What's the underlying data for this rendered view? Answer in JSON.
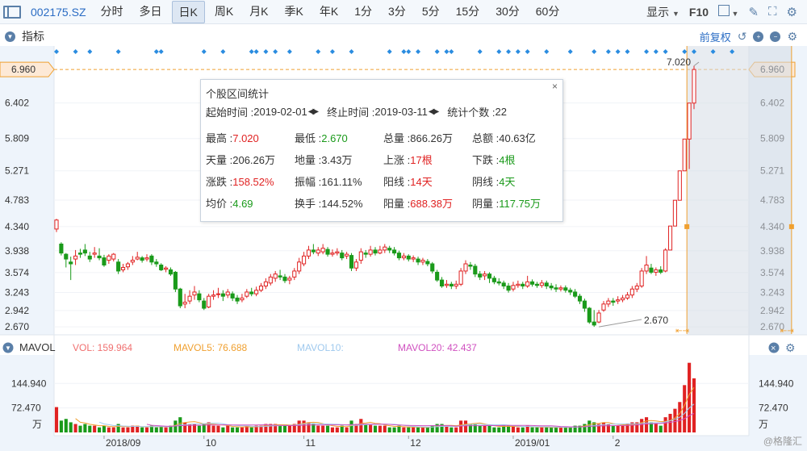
{
  "toolbar": {
    "code": "002175.SZ",
    "periods": [
      "分时",
      "多日",
      "日K",
      "周K",
      "月K",
      "季K",
      "年K",
      "1分",
      "3分",
      "5分",
      "15分",
      "30分",
      "60分"
    ],
    "active_period": "日K",
    "display_label": "显示",
    "f10_label": "F10",
    "icons": [
      "sidebar-toggle-icon",
      "checkbox-icon",
      "pen-icon",
      "expand-icon",
      "settings-icon"
    ]
  },
  "indicator_bar": {
    "label": "指标",
    "adjust_label": "前复权",
    "icons": [
      "collapse-icon",
      "undo-icon",
      "plus-icon",
      "minus-icon",
      "settings-icon"
    ]
  },
  "price_axis": {
    "current_price": "6.960",
    "ticks": [
      "6.402",
      "5.809",
      "5.271",
      "4.783",
      "4.340",
      "3.938",
      "3.574",
      "3.243",
      "2.942",
      "2.670"
    ]
  },
  "annotations": {
    "high_label": "7.020",
    "low_label": "2.670"
  },
  "popup": {
    "title": "个股区间统计",
    "close": "×",
    "start_label": "起始时间 :",
    "start_value": "2019-02-01",
    "end_label": "终止时间 :",
    "end_value": "2019-03-11",
    "count_label": "统计个数 :",
    "count_value": "22",
    "rows": [
      [
        {
          "label": "最高 :",
          "value": "7.020",
          "color": "red"
        },
        {
          "label": "最低 :",
          "value": "2.670",
          "color": "green"
        },
        {
          "label": "总量 :",
          "value": "866.26万",
          "color": ""
        },
        {
          "label": "总额 :",
          "value": "40.63亿",
          "color": ""
        }
      ],
      [
        {
          "label": "天量 :",
          "value": "206.26万",
          "color": ""
        },
        {
          "label": "地量 :",
          "value": "3.43万",
          "color": ""
        },
        {
          "label": "上涨 :",
          "value": "17根",
          "color": "red"
        },
        {
          "label": "下跌 :",
          "value": "4根",
          "color": "green"
        }
      ],
      [
        {
          "label": "涨跌 :",
          "value": "158.52%",
          "color": "red"
        },
        {
          "label": "振幅 :",
          "value": "161.11%",
          "color": ""
        },
        {
          "label": "阳线 :",
          "value": "14天",
          "color": "red"
        },
        {
          "label": "阴线 :",
          "value": "4天",
          "color": "green"
        }
      ],
      [
        {
          "label": "均价 :",
          "value": "4.69",
          "color": "green"
        },
        {
          "label": "换手 :",
          "value": "144.52%",
          "color": ""
        },
        {
          "label": "阳量 :",
          "value": "688.38万",
          "color": "red"
        },
        {
          "label": "阴量 :",
          "value": "117.75万",
          "color": "green"
        }
      ]
    ]
  },
  "volume_bar": {
    "title": "MAVOL",
    "vol": "VOL: 159.964",
    "mavol5": "MAVOL5: 76.688",
    "mavol10": "MAVOL10:",
    "mavol20": "MAVOL20: 42.437",
    "ticks": [
      "144.940",
      "72.470"
    ],
    "unit": "万"
  },
  "x_labels": [
    "2018/09",
    "10",
    "11",
    "12",
    "2019/01",
    "2"
  ],
  "watermark": "@格隆汇",
  "colors": {
    "up": "#e02222",
    "down": "#1a9a1a",
    "accent": "#2a6cc4",
    "selection": "#f0a030",
    "mavol5": "#f0a030",
    "mavol10": "#9fc9ee",
    "mavol20": "#d050c0"
  },
  "chart_data": {
    "type": "candlestick",
    "price_range": [
      2.55,
      7.15
    ],
    "volume_range": [
      0,
      210
    ],
    "volume_unit": "万",
    "selection": {
      "start_index": 133,
      "end_index": 154
    },
    "candles": [
      [
        4.3,
        4.45,
        4.47,
        4.25,
        75
      ],
      [
        4.05,
        3.9,
        4.08,
        3.86,
        35
      ],
      [
        3.88,
        3.8,
        3.9,
        3.66,
        40
      ],
      [
        3.75,
        3.72,
        3.84,
        3.45,
        30
      ],
      [
        3.8,
        3.85,
        3.95,
        3.7,
        25
      ],
      [
        3.9,
        3.88,
        3.97,
        3.82,
        20
      ],
      [
        3.95,
        3.9,
        4.05,
        3.85,
        25
      ],
      [
        3.85,
        3.8,
        3.92,
        3.75,
        20
      ],
      [
        3.88,
        3.9,
        4.0,
        3.82,
        20
      ],
      [
        3.85,
        3.82,
        3.98,
        3.78,
        15
      ],
      [
        3.82,
        3.7,
        3.87,
        3.67,
        20
      ],
      [
        3.78,
        3.85,
        3.88,
        3.72,
        15
      ],
      [
        3.8,
        3.88,
        3.9,
        3.76,
        15
      ],
      [
        3.75,
        3.6,
        3.8,
        3.55,
        25
      ],
      [
        3.62,
        3.66,
        3.72,
        3.58,
        15
      ],
      [
        3.67,
        3.72,
        3.75,
        3.62,
        15
      ],
      [
        3.75,
        3.78,
        3.85,
        3.7,
        20
      ],
      [
        3.8,
        3.83,
        3.92,
        3.78,
        20
      ],
      [
        3.82,
        3.78,
        3.85,
        3.74,
        15
      ],
      [
        3.8,
        3.82,
        3.88,
        3.76,
        15
      ],
      [
        3.85,
        3.75,
        3.88,
        3.7,
        20
      ],
      [
        3.75,
        3.72,
        3.8,
        3.67,
        15
      ],
      [
        3.7,
        3.62,
        3.73,
        3.6,
        20
      ],
      [
        3.63,
        3.65,
        3.68,
        3.58,
        15
      ],
      [
        3.62,
        3.55,
        3.66,
        3.52,
        20
      ],
      [
        3.58,
        3.3,
        3.6,
        3.25,
        35
      ],
      [
        3.3,
        3.02,
        3.32,
        2.98,
        45
      ],
      [
        3.05,
        3.08,
        3.22,
        2.98,
        30
      ],
      [
        3.1,
        3.18,
        3.28,
        3.05,
        25
      ],
      [
        3.2,
        3.25,
        3.35,
        3.12,
        25
      ],
      [
        3.22,
        3.12,
        3.28,
        3.08,
        20
      ],
      [
        3.1,
        2.98,
        3.15,
        2.95,
        25
      ],
      [
        3.0,
        3.18,
        3.22,
        2.98,
        30
      ],
      [
        3.18,
        3.2,
        3.28,
        3.12,
        20
      ],
      [
        3.22,
        3.22,
        3.32,
        3.15,
        20
      ],
      [
        3.22,
        3.18,
        3.28,
        3.1,
        15
      ],
      [
        3.2,
        3.25,
        3.3,
        3.15,
        20
      ],
      [
        3.22,
        3.15,
        3.26,
        3.1,
        15
      ],
      [
        3.15,
        3.1,
        3.2,
        3.05,
        15
      ],
      [
        3.12,
        3.15,
        3.22,
        3.08,
        15
      ],
      [
        3.18,
        3.25,
        3.3,
        3.15,
        20
      ],
      [
        3.25,
        3.22,
        3.32,
        3.18,
        15
      ],
      [
        3.22,
        3.28,
        3.34,
        3.18,
        20
      ],
      [
        3.28,
        3.35,
        3.4,
        3.25,
        20
      ],
      [
        3.35,
        3.42,
        3.48,
        3.3,
        25
      ],
      [
        3.4,
        3.5,
        3.55,
        3.36,
        25
      ],
      [
        3.48,
        3.55,
        3.6,
        3.42,
        25
      ],
      [
        3.52,
        3.5,
        3.62,
        3.45,
        20
      ],
      [
        3.5,
        3.44,
        3.55,
        3.4,
        20
      ],
      [
        3.45,
        3.48,
        3.52,
        3.38,
        20
      ],
      [
        3.5,
        3.6,
        3.65,
        3.45,
        25
      ],
      [
        3.6,
        3.75,
        3.82,
        3.55,
        35
      ],
      [
        3.72,
        3.85,
        3.92,
        3.68,
        35
      ],
      [
        3.85,
        3.95,
        4.02,
        3.8,
        30
      ],
      [
        3.95,
        3.92,
        4.05,
        3.88,
        25
      ],
      [
        3.9,
        3.95,
        4.0,
        3.85,
        20
      ],
      [
        3.92,
        3.98,
        4.05,
        3.88,
        20
      ],
      [
        3.96,
        3.88,
        4.0,
        3.84,
        20
      ],
      [
        3.88,
        3.9,
        3.96,
        3.84,
        15
      ],
      [
        3.9,
        3.92,
        3.98,
        3.86,
        15
      ],
      [
        3.9,
        3.82,
        3.95,
        3.78,
        20
      ],
      [
        3.85,
        3.88,
        3.92,
        3.8,
        15
      ],
      [
        3.86,
        3.65,
        3.9,
        3.6,
        35
      ],
      [
        3.65,
        3.75,
        3.8,
        3.6,
        25
      ],
      [
        3.78,
        3.92,
        3.98,
        3.72,
        40
      ],
      [
        3.9,
        3.88,
        3.95,
        3.82,
        25
      ],
      [
        3.88,
        3.95,
        4.02,
        3.84,
        25
      ],
      [
        3.95,
        3.9,
        4.0,
        3.86,
        20
      ],
      [
        3.9,
        3.95,
        4.02,
        3.88,
        20
      ],
      [
        3.95,
        4.0,
        4.05,
        3.9,
        20
      ],
      [
        3.98,
        3.95,
        4.02,
        3.9,
        15
      ],
      [
        3.95,
        3.9,
        4.0,
        3.86,
        15
      ],
      [
        3.9,
        3.82,
        3.94,
        3.78,
        20
      ],
      [
        3.82,
        3.85,
        3.9,
        3.78,
        15
      ],
      [
        3.85,
        3.8,
        3.88,
        3.76,
        15
      ],
      [
        3.8,
        3.82,
        3.86,
        3.75,
        15
      ],
      [
        3.8,
        3.75,
        3.84,
        3.7,
        15
      ],
      [
        3.75,
        3.78,
        3.82,
        3.7,
        15
      ],
      [
        3.76,
        3.72,
        3.8,
        3.68,
        15
      ],
      [
        3.72,
        3.6,
        3.75,
        3.56,
        20
      ],
      [
        3.58,
        3.45,
        3.62,
        3.42,
        25
      ],
      [
        3.45,
        3.35,
        3.5,
        3.32,
        25
      ],
      [
        3.36,
        3.38,
        3.45,
        3.32,
        20
      ],
      [
        3.38,
        3.35,
        3.42,
        3.3,
        15
      ],
      [
        3.35,
        3.38,
        3.44,
        3.3,
        15
      ],
      [
        3.38,
        3.6,
        3.65,
        3.35,
        35
      ],
      [
        3.6,
        3.72,
        3.78,
        3.55,
        35
      ],
      [
        3.7,
        3.68,
        3.75,
        3.62,
        25
      ],
      [
        3.68,
        3.55,
        3.72,
        3.5,
        25
      ],
      [
        3.55,
        3.5,
        3.6,
        3.45,
        20
      ],
      [
        3.52,
        3.55,
        3.6,
        3.45,
        20
      ],
      [
        3.55,
        3.48,
        3.58,
        3.4,
        20
      ],
      [
        3.48,
        3.42,
        3.52,
        3.38,
        15
      ],
      [
        3.42,
        3.4,
        3.48,
        3.36,
        15
      ],
      [
        3.4,
        3.35,
        3.44,
        3.3,
        20
      ],
      [
        3.35,
        3.28,
        3.4,
        3.24,
        20
      ],
      [
        3.3,
        3.36,
        3.42,
        3.26,
        20
      ],
      [
        3.36,
        3.38,
        3.44,
        3.32,
        15
      ],
      [
        3.38,
        3.35,
        3.42,
        3.3,
        15
      ],
      [
        3.35,
        3.42,
        3.52,
        3.32,
        20
      ],
      [
        3.42,
        3.38,
        3.46,
        3.34,
        15
      ],
      [
        3.38,
        3.36,
        3.42,
        3.32,
        15
      ],
      [
        3.36,
        3.4,
        3.45,
        3.32,
        15
      ],
      [
        3.4,
        3.35,
        3.44,
        3.3,
        15
      ],
      [
        3.35,
        3.32,
        3.4,
        3.28,
        15
      ],
      [
        3.32,
        3.3,
        3.38,
        3.25,
        15
      ],
      [
        3.3,
        3.32,
        3.36,
        3.26,
        15
      ],
      [
        3.32,
        3.28,
        3.36,
        3.24,
        15
      ],
      [
        3.28,
        3.25,
        3.32,
        3.2,
        15
      ],
      [
        3.25,
        3.18,
        3.3,
        3.15,
        20
      ],
      [
        3.18,
        3.1,
        3.22,
        3.05,
        20
      ],
      [
        3.1,
        2.98,
        3.14,
        2.92,
        25
      ],
      [
        2.98,
        2.75,
        3.0,
        2.72,
        35
      ],
      [
        2.75,
        2.7,
        2.95,
        2.67,
        30
      ],
      [
        2.75,
        2.9,
        2.95,
        2.73,
        25
      ],
      [
        2.95,
        3.05,
        3.1,
        2.92,
        30
      ],
      [
        3.05,
        3.1,
        3.15,
        3.0,
        25
      ],
      [
        3.1,
        3.08,
        3.15,
        3.02,
        20
      ],
      [
        3.1,
        3.12,
        3.18,
        3.05,
        20
      ],
      [
        3.12,
        3.15,
        3.2,
        3.08,
        20
      ],
      [
        3.15,
        3.2,
        3.25,
        3.12,
        25
      ],
      [
        3.2,
        3.3,
        3.35,
        3.15,
        30
      ],
      [
        3.3,
        3.35,
        3.4,
        3.25,
        30
      ],
      [
        3.35,
        3.6,
        3.65,
        3.32,
        40
      ],
      [
        3.6,
        3.7,
        3.85,
        3.55,
        45
      ],
      [
        3.65,
        3.58,
        3.72,
        3.55,
        30
      ],
      [
        3.58,
        3.62,
        3.66,
        3.52,
        25
      ],
      [
        3.62,
        3.58,
        3.68,
        3.55,
        20
      ],
      [
        3.6,
        3.95,
        3.98,
        3.58,
        45
      ],
      [
        3.95,
        4.35,
        4.35,
        3.95,
        55
      ],
      [
        4.35,
        4.78,
        4.78,
        4.35,
        70
      ],
      [
        4.78,
        5.27,
        5.27,
        4.78,
        90
      ],
      [
        5.27,
        5.8,
        5.8,
        5.27,
        140
      ],
      [
        5.8,
        6.4,
        6.4,
        5.3,
        206
      ],
      [
        6.4,
        6.96,
        7.02,
        6.3,
        160
      ]
    ]
  }
}
